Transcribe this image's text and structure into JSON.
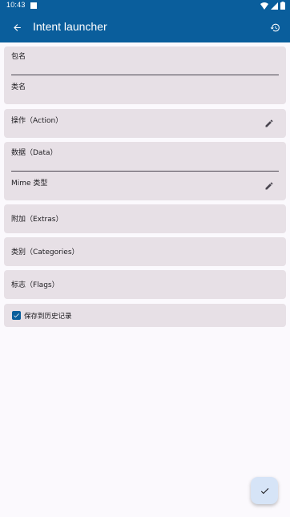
{
  "status_bar": {
    "time": "10:43"
  },
  "app_bar": {
    "title": "Intent launcher"
  },
  "fields": {
    "package_label": "包名",
    "class_label": "类名",
    "action_label": "操作（Action）",
    "data_label": "数据（Data）",
    "mime_label": "Mime 类型",
    "extras_label": "附加（Extras）",
    "categories_label": "类别（Categories）",
    "flags_label": "标志（Flags）"
  },
  "save_history": {
    "label": "保存到历史记录",
    "checked": true
  },
  "colors": {
    "primary": "#0a5e9c",
    "card": "#e7e0e6",
    "background": "#fbf9fd",
    "fab": "#d6e4f7"
  },
  "icons": {
    "back": "arrow-left-icon",
    "history": "history-icon",
    "edit": "pencil-icon",
    "confirm": "check-icon"
  }
}
